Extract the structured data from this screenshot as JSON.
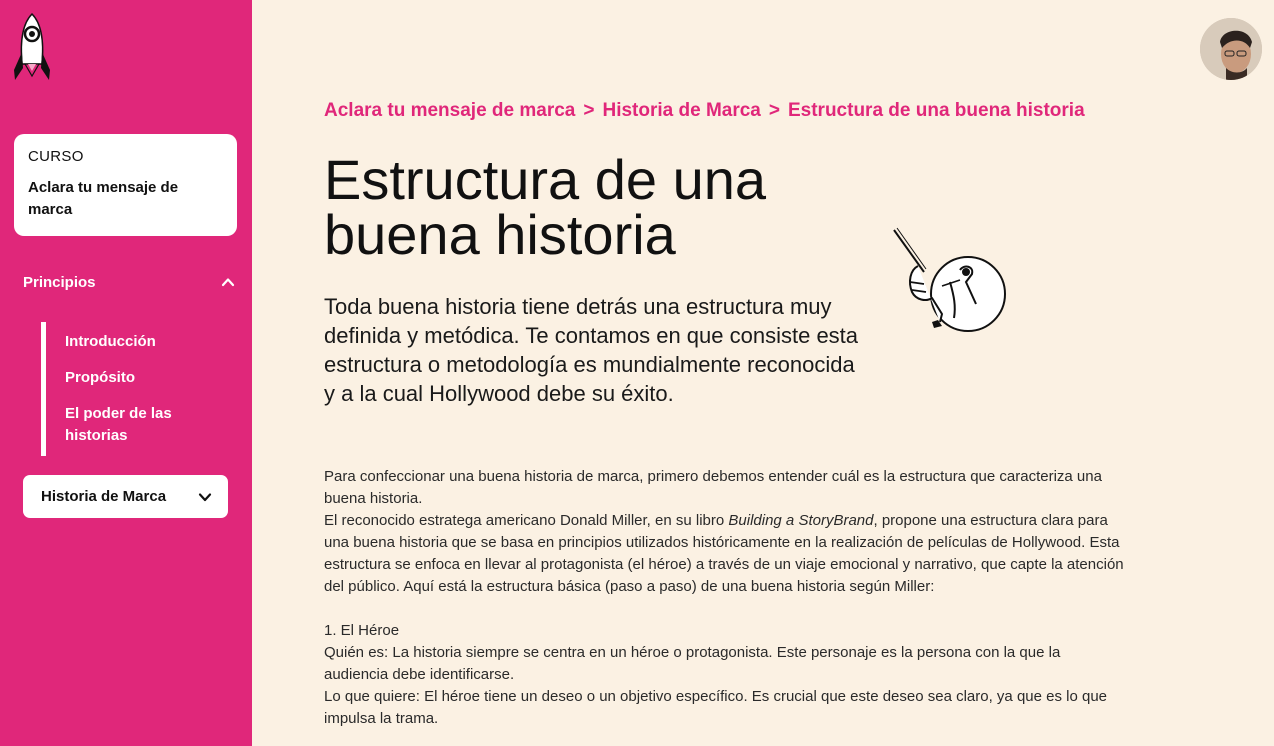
{
  "sidebar": {
    "course_kicker": "CURSO",
    "course_title": "Aclara tu mensaje de marca",
    "section_title": "Principios",
    "items": [
      {
        "label": "Introducción"
      },
      {
        "label": "Propósito"
      },
      {
        "label": "El poder de las historias"
      }
    ],
    "module_label": "Historia de Marca"
  },
  "breadcrumb": {
    "level1": "Aclara tu mensaje de marca",
    "level2": "Historia de Marca",
    "level3": "Estructura de una buena historia",
    "separator": ">"
  },
  "page": {
    "title": "Estructura de una buena historia",
    "lead": "Toda buena historia tiene detrás una estructura muy definida y metódica. Te contamos en que consiste esta estructura o metodología es mundialmente reconocida y a la cual Hollywood debe su éxito."
  },
  "content": {
    "p1": "Para confeccionar una buena historia de marca, primero debemos entender cuál es la estructura que caracteriza una buena historia.",
    "p2_before": "El reconocido estratega americano Donald Miller, en su libro ",
    "p2_book": "Building a StoryBrand",
    "p2_after": ", propone una estructura clara para una buena historia que se basa en principios utilizados históricamente en la realización de películas de Hollywood. Esta estructura se enfoca en llevar al protagonista (el héroe) a través de un viaje emocional y narrativo, que capte la atención del público. Aquí está la estructura básica (paso a paso) de una buena historia según Miller:",
    "step1_title": "1. El Héroe",
    "step1_who": "Quién es: La historia siempre se centra en un héroe o protagonista. Este personaje es la persona con la que la audiencia debe identificarse.",
    "step1_want": "Lo que quiere: El héroe tiene un deseo o un objetivo específico. Es crucial que este deseo sea claro, ya que es lo que impulsa la trama."
  },
  "colors": {
    "brand_pink": "#e0277a",
    "background": "#fbf1e3"
  },
  "icons": {
    "logo": "rocket-icon",
    "section_toggle": "chevron-up-icon",
    "module_toggle": "chevron-down-icon",
    "illustration": "hand-pointer-illustration"
  }
}
